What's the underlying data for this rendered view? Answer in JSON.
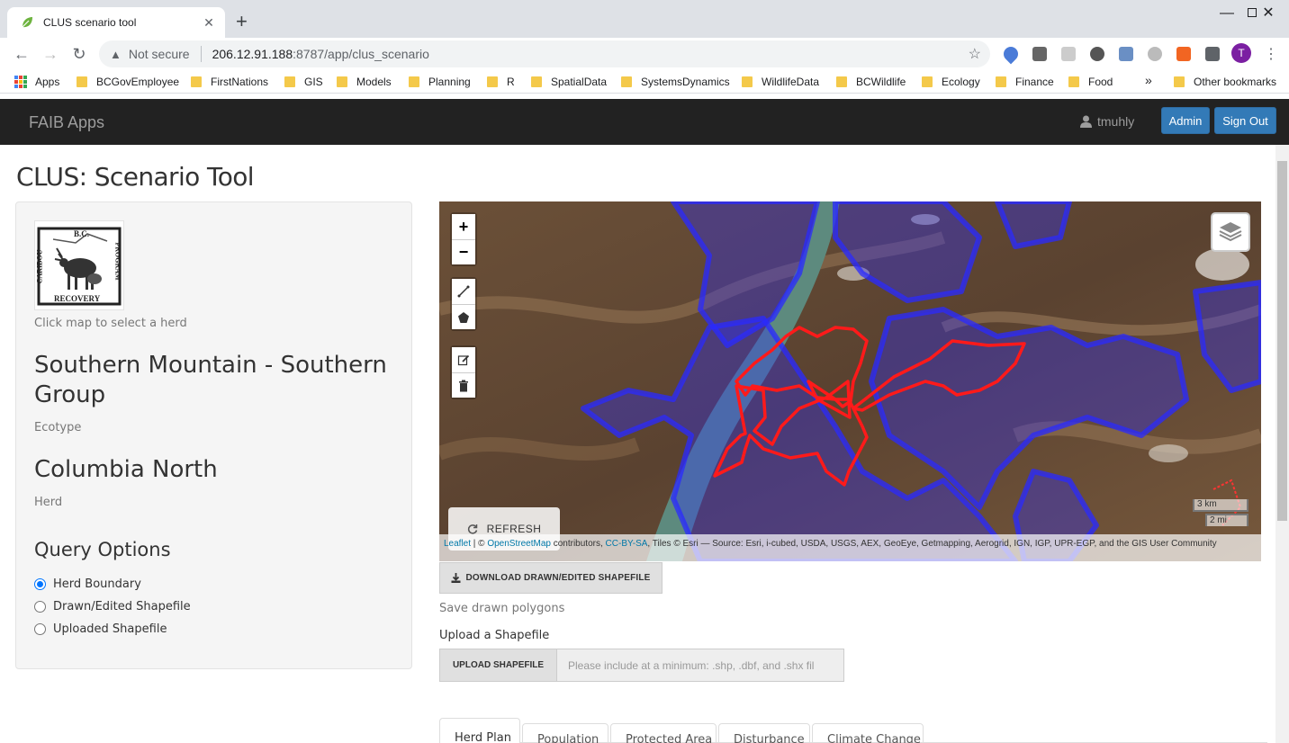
{
  "browser": {
    "tab_title": "CLUS scenario tool",
    "tab_close": "✕",
    "new_tab": "+",
    "address_warning": "Not secure",
    "url_host": "206.12.91.188",
    "url_rest": ":8787/app/clus_scenario",
    "bookmarks": [
      "Apps",
      "BCGovEmployee",
      "FirstNations",
      "GIS",
      "Models",
      "Planning",
      "R",
      "SpatialData",
      "SystemsDynamics",
      "WildlifeData",
      "BCWildlife",
      "Ecology",
      "Finance",
      "Food"
    ],
    "bookmarks_overflow": "»",
    "other_bookmarks": "Other bookmarks",
    "profile_initial": "T"
  },
  "navbar": {
    "brand": "FAIB Apps",
    "user": "tmuhly",
    "admin_label": "Admin",
    "signout_label": "Sign Out"
  },
  "page": {
    "title": "CLUS: Scenario Tool"
  },
  "sidebar": {
    "logo_top": "B.C.",
    "logo_left": "CARIBOU",
    "logo_right": "PROGRAM",
    "logo_bottom": "RECOVERY",
    "hint": "Click map to select a herd",
    "ecotype_value": "Southern Mountain - Southern Group",
    "ecotype_label": "Ecotype",
    "herd_value": "Columbia North",
    "herd_label": "Herd",
    "query_title": "Query Options",
    "options": [
      {
        "label": "Herd Boundary",
        "selected": true
      },
      {
        "label": "Drawn/Edited Shapefile",
        "selected": false
      },
      {
        "label": "Uploaded Shapefile",
        "selected": false
      }
    ]
  },
  "map": {
    "zoom_in": "+",
    "zoom_out": "−",
    "refresh_label": "REFRESH",
    "scale_km": "3 km",
    "scale_mi": "2 mi",
    "attribution_leaflet": "Leaflet",
    "attribution_sep": " | © ",
    "attribution_osm": "OpenStreetMap",
    "attribution_mid": " contributors, ",
    "attribution_ccbysa": "CC-BY-SA",
    "attribution_tail": ", Tiles © Esri — Source: Esri, i-cubed, USDA, USGS, AEX, GeoEye, Getmapping, Aerogrid, IGN, IGP, UPR-EGP, and the GIS User Community",
    "colors": {
      "herd_polygons": "#2a2aff",
      "selected_herd": "#ff1a1a"
    }
  },
  "controls": {
    "download_label": "DOWNLOAD DRAWN/EDITED SHAPEFILE",
    "save_hint": "Save drawn polygons",
    "upload_title": "Upload a Shapefile",
    "upload_button": "UPLOAD SHAPEFILE",
    "upload_placeholder": "Please include at a minimum: .shp, .dbf, and .shx fil"
  },
  "tabs": [
    "Herd Plan",
    "Population",
    "Protected Area",
    "Disturbance",
    "Climate Change"
  ]
}
